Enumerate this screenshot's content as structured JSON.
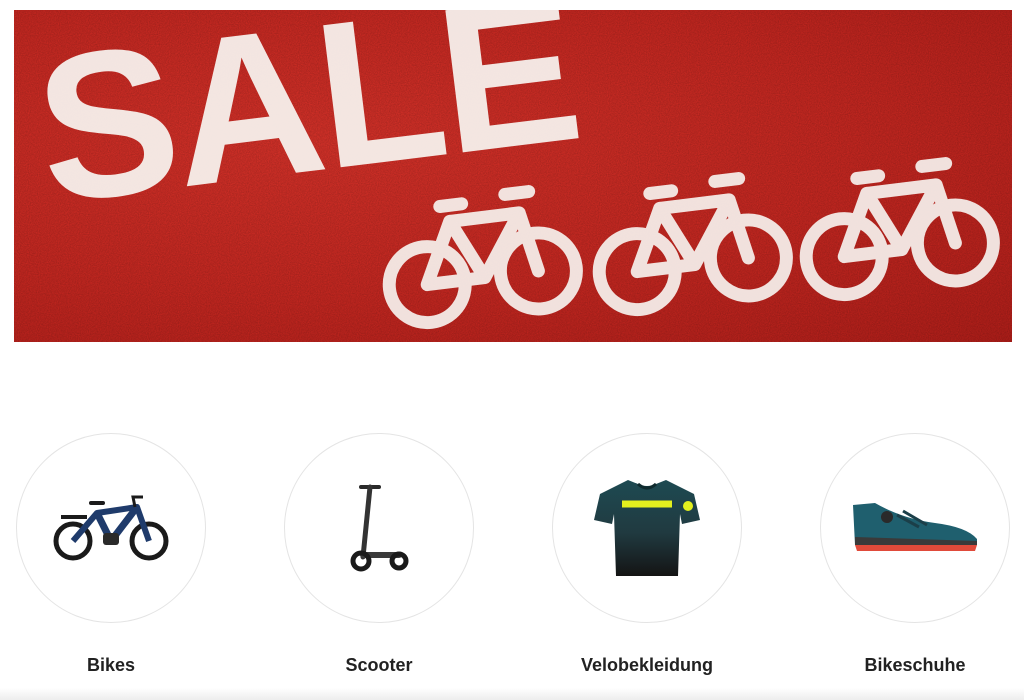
{
  "banner": {
    "headline": "SALE",
    "background_color": "#d32b24",
    "decorative_icons": [
      "bicycle-icon",
      "bicycle-icon",
      "bicycle-icon"
    ]
  },
  "categories": [
    {
      "label": "Bikes",
      "icon": "e-bike-icon"
    },
    {
      "label": "Scooter",
      "icon": "scooter-icon"
    },
    {
      "label": "Velobekleidung",
      "icon": "jersey-icon"
    },
    {
      "label": "Bikeschuhe",
      "icon": "bike-shoe-icon"
    }
  ],
  "colors": {
    "banner_red": "#d32b24",
    "stencil_white": "#f7f2ee",
    "label_text": "#222222",
    "circle_border": "#e4e4e4",
    "bike_frame_blue": "#1f3b6b",
    "jersey_accent": "#e3f01e",
    "shoe_teal": "#1f5f6e",
    "shoe_sole_red": "#e04a3a"
  }
}
